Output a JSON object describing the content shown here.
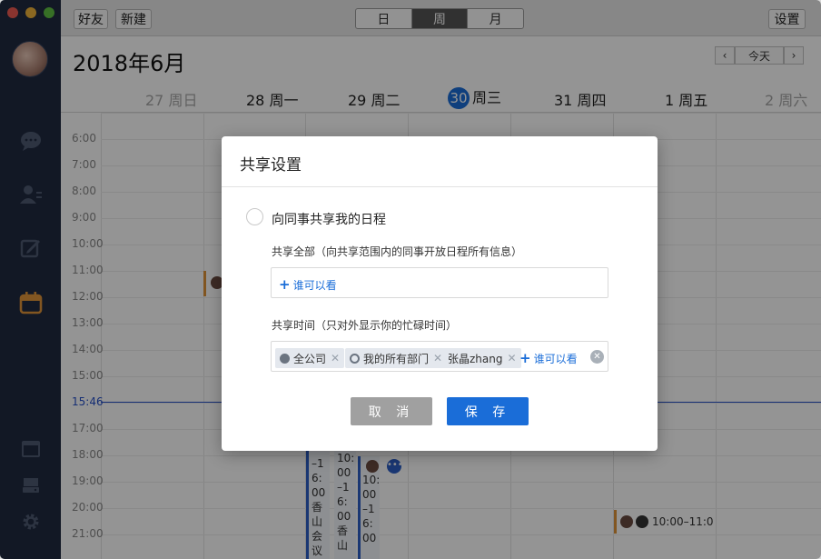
{
  "toolbar": {
    "friends": "好友",
    "new": "新建",
    "settings": "设置"
  },
  "view_tabs": [
    "日",
    "周",
    "月"
  ],
  "active_view": "周",
  "month_title": "2018年6月",
  "nav": {
    "prev": "‹",
    "today": "今天",
    "next": "›"
  },
  "days": [
    {
      "num": "27",
      "name": "周日",
      "dim": true
    },
    {
      "num": "28",
      "name": "周一",
      "dim": false
    },
    {
      "num": "29",
      "name": "周二",
      "dim": false
    },
    {
      "num": "30",
      "name": "周三",
      "dim": false,
      "today": true
    },
    {
      "num": "31",
      "name": "周四",
      "dim": false
    },
    {
      "num": "1",
      "name": "周五",
      "dim": false
    },
    {
      "num": "2",
      "name": "周六",
      "dim": true
    }
  ],
  "hours": [
    "6:00",
    "7:00",
    "8:00",
    "9:00",
    "10:00",
    "11:00",
    "12:00",
    "13:00",
    "14:00",
    "15:00",
    "15:46",
    "17:00",
    "18:00",
    "19:00",
    "20:00",
    "21:00"
  ],
  "now_time": "15:46",
  "events": {
    "a": "–1\n6:\n00\n香\n山\n会\n议",
    "b": "10:\n00\n–1\n6:\n00\n香\n山",
    "c": "10:\n00\n–1\n6:\n00",
    "friday": "10:00–11:0"
  },
  "modal": {
    "title": "共享设置",
    "radio_label": "向同事共享我的日程",
    "share_all_label": "共享全部（向共享范围内的同事开放日程所有信息）",
    "share_all_add": "谁可以看",
    "share_time_label": "共享时间（只对外显示你的忙碌时间）",
    "tags": [
      {
        "label": "全公司",
        "icon": "globe-icon"
      },
      {
        "label": "我的所有部门",
        "icon": "circle-icon"
      },
      {
        "label": "张晶zhang",
        "icon": ""
      }
    ],
    "share_time_add": "谁可以看",
    "cancel": "取 消",
    "save": "保 存"
  },
  "colors": {
    "accent": "#1a6dd8",
    "sidebar": "#1f2a40",
    "calendar_icon": "#e0953a"
  }
}
